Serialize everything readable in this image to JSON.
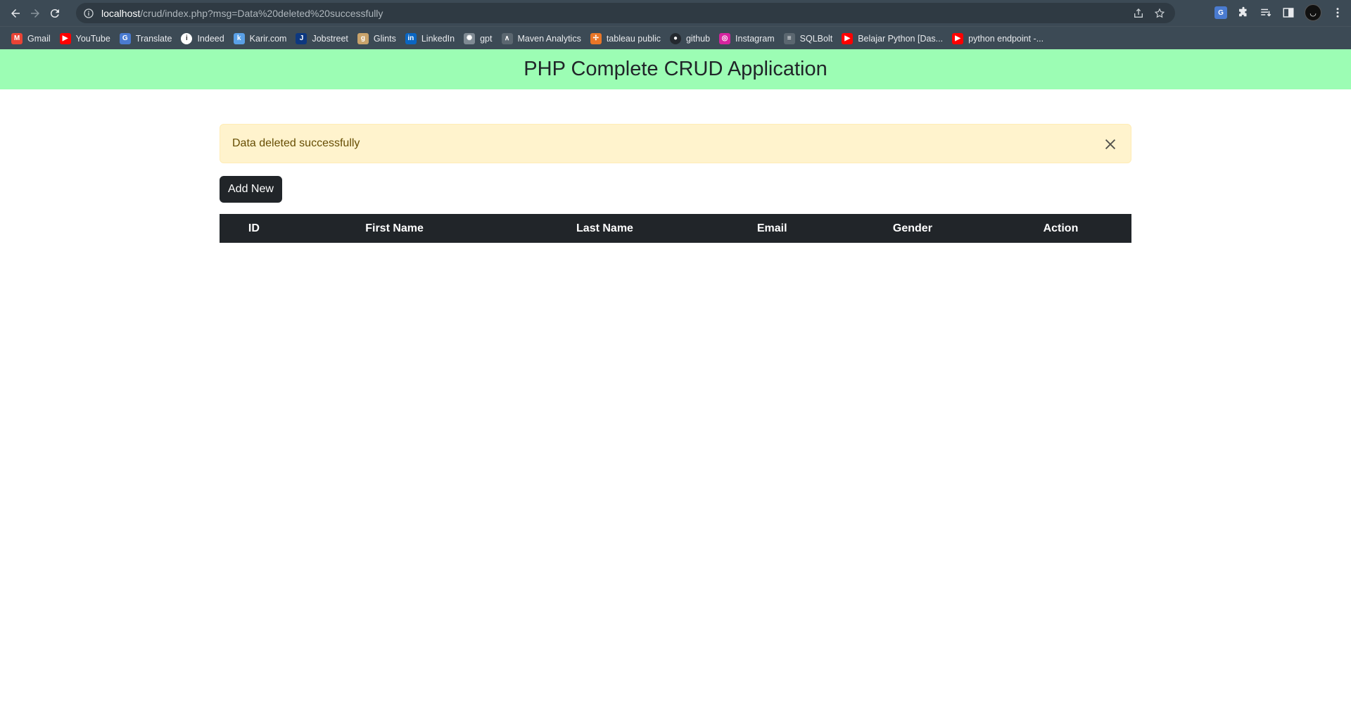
{
  "browser": {
    "url_host": "localhost",
    "url_path": "/crud/index.php?msg=Data%20deleted%20successfully",
    "bookmarks": [
      {
        "label": "Gmail",
        "icon": "gmail-icon",
        "color": "#ea4335",
        "glyph": "M"
      },
      {
        "label": "YouTube",
        "icon": "youtube-icon",
        "color": "#ff0000",
        "glyph": "▶"
      },
      {
        "label": "Translate",
        "icon": "translate-icon",
        "color": "#4a7bd0",
        "glyph": "G"
      },
      {
        "label": "Indeed",
        "icon": "indeed-icon",
        "color": "#ffffff",
        "glyph": "i"
      },
      {
        "label": "Karir.com",
        "icon": "karir-icon",
        "color": "#5aa0e6",
        "glyph": "k"
      },
      {
        "label": "Jobstreet",
        "icon": "jobstreet-icon",
        "color": "#0d3880",
        "glyph": "J"
      },
      {
        "label": "Glints",
        "icon": "glints-icon",
        "color": "#c9a36b",
        "glyph": "g"
      },
      {
        "label": "LinkedIn",
        "icon": "linkedin-icon",
        "color": "#0a66c2",
        "glyph": "in"
      },
      {
        "label": "gpt",
        "icon": "chatgpt-icon",
        "color": "#7f8a93",
        "glyph": "✺"
      },
      {
        "label": "Maven Analytics",
        "icon": "maven-icon",
        "color": "#5b6770",
        "glyph": "∧"
      },
      {
        "label": "tableau public",
        "icon": "tableau-icon",
        "color": "#e97627",
        "glyph": "✢"
      },
      {
        "label": "github",
        "icon": "github-icon",
        "color": "#24292f",
        "glyph": "●"
      },
      {
        "label": "Instagram",
        "icon": "instagram-icon",
        "color": "#d6249f",
        "glyph": "◎"
      },
      {
        "label": "SQLBolt",
        "icon": "sqlbolt-icon",
        "color": "#5b6770",
        "glyph": "≡"
      },
      {
        "label": "Belajar Python [Das...",
        "icon": "youtube-icon",
        "color": "#ff0000",
        "glyph": "▶"
      },
      {
        "label": "python endpoint -...",
        "icon": "youtube-icon",
        "color": "#ff0000",
        "glyph": "▶"
      }
    ]
  },
  "header": {
    "title": "PHP Complete CRUD Application"
  },
  "alert": {
    "message": "Data deleted successfully"
  },
  "actions": {
    "add_new_label": "Add New"
  },
  "table": {
    "columns": [
      "ID",
      "First Name",
      "Last Name",
      "Email",
      "Gender",
      "Action"
    ],
    "rows": []
  },
  "colors": {
    "header_bg": "#9cfdb4",
    "alert_bg": "#fff3cd",
    "dark": "#212529"
  }
}
